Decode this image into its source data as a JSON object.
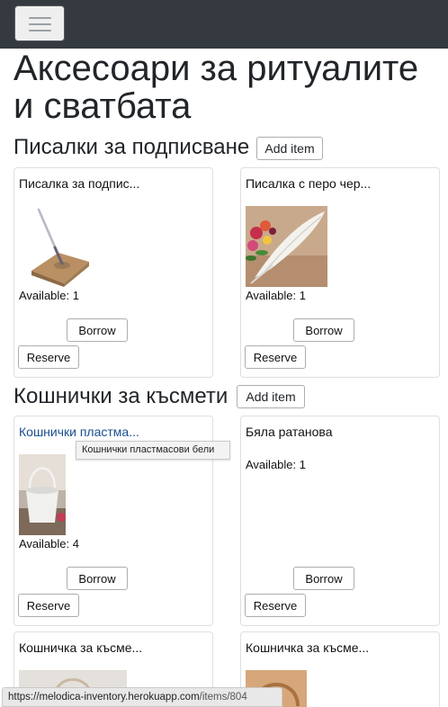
{
  "navbar": {
    "toggle_icon": "hamburger-menu-icon",
    "background": "#343a40"
  },
  "page": {
    "title": "Аксесоари за ритуалите и сватбата"
  },
  "sections": [
    {
      "heading": "Писалки за подписване",
      "add_label": "Add item",
      "items": [
        {
          "title": "Писалка за подпис...",
          "image_icon": "wedding-pen-stand-image",
          "available": "Available: 1",
          "borrow_label": "Borrow",
          "reserve_label": "Reserve"
        },
        {
          "title": "Писалка с перо чер...",
          "image_icon": "feather-pen-with-flowers-image",
          "available": "Available: 1",
          "borrow_label": "Borrow",
          "reserve_label": "Reserve"
        }
      ]
    },
    {
      "heading": "Кошнички за късмети",
      "add_label": "Add item",
      "items": [
        {
          "title": "Кошнички пластма...",
          "image_icon": "white-basket-image",
          "available": "Available: 4",
          "borrow_label": "Borrow",
          "reserve_label": "Reserve"
        },
        {
          "title": "Бяла ратанова",
          "available": "Available: 1",
          "borrow_label": "Borrow",
          "reserve_label": "Reserve"
        },
        {
          "title": "Кошничка за късме...",
          "image_icon": "basket-image"
        },
        {
          "title": "Кошничка за късме...",
          "image_icon": "wicker-basket-image"
        }
      ]
    }
  ],
  "tooltip": {
    "text": "Кошнички пластмасови бели"
  },
  "status_bar": {
    "host": "https://melodica-inventory.herokuapp.com",
    "path": "/items/804"
  },
  "colors": {
    "link": "#1a4e8f",
    "card_border": "#dfdfdf",
    "button_border": "#adadad"
  }
}
